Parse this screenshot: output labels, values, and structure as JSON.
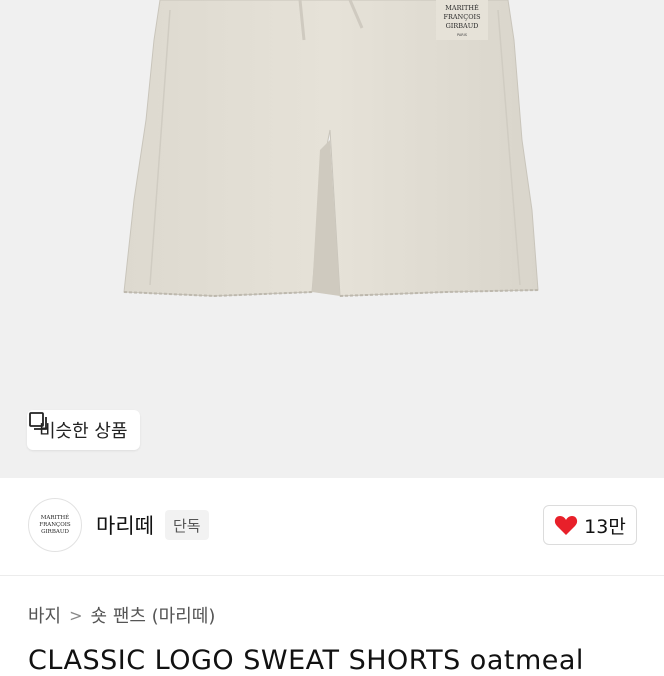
{
  "product_image": {
    "logo_text": "MARITHÉ FRANÇOIS GIRBAUD PARIS",
    "similar_button_label": "비슷한 상품",
    "similar_icon": "similar-items-icon"
  },
  "seller": {
    "logo_text": "MARITHÉ FRANÇOIS GIRBAUD",
    "name": "마리떼",
    "badge": "단독",
    "likes_count": "13만",
    "heart_color": "#e8202a"
  },
  "breadcrumb": {
    "category": "바지",
    "separator": ">",
    "subcategory": "숏 팬츠 (마리떼)"
  },
  "product": {
    "title": "CLASSIC LOGO SWEAT SHORTS oatmeal"
  }
}
